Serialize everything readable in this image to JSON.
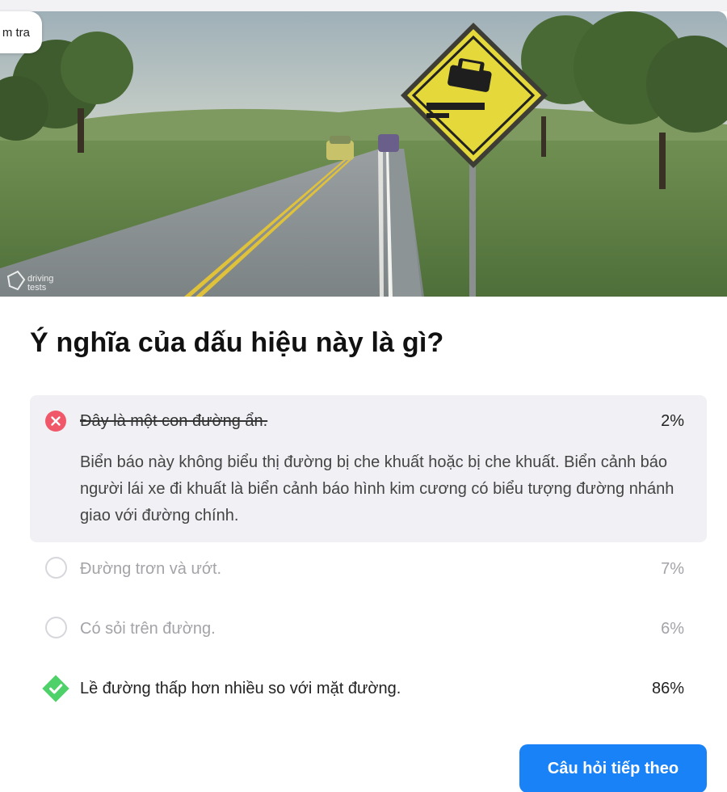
{
  "header": {
    "pill_label": "m tra"
  },
  "hero": {
    "watermark_line1": "driving",
    "watermark_line2": "tests"
  },
  "question": {
    "title": "Ý nghĩa của dấu hiệu này là gì?"
  },
  "answers": [
    {
      "text": "Đây là một con đường ẩn.",
      "percent": "2%",
      "state": "wrong",
      "explanation": "Biển báo này không biểu thị đường bị che khuất hoặc bị che khuất. Biển cảnh báo người lái xe đi khuất là biển cảnh báo hình kim cương có biểu tượng đường nhánh giao với đường chính."
    },
    {
      "text": "Đường trơn và ướt.",
      "percent": "7%",
      "state": "unselected"
    },
    {
      "text": "Có sỏi trên đường.",
      "percent": "6%",
      "state": "unselected"
    },
    {
      "text": "Lề đường thấp hơn nhiều so với mặt đường.",
      "percent": "86%",
      "state": "correct"
    }
  ],
  "footer": {
    "next_label": "Câu hỏi tiếp theo"
  },
  "colors": {
    "accent": "#1a82f7",
    "wrong": "#f0586a",
    "correct": "#4fd16a",
    "wrong_bg": "#f1f1f5",
    "muted_text": "#a3a3a8"
  },
  "icons": {
    "wrong": "x-circle-icon",
    "correct": "check-diamond-icon",
    "unselected": "radio-circle-icon",
    "sign": "soft-shoulder-sign-icon"
  }
}
